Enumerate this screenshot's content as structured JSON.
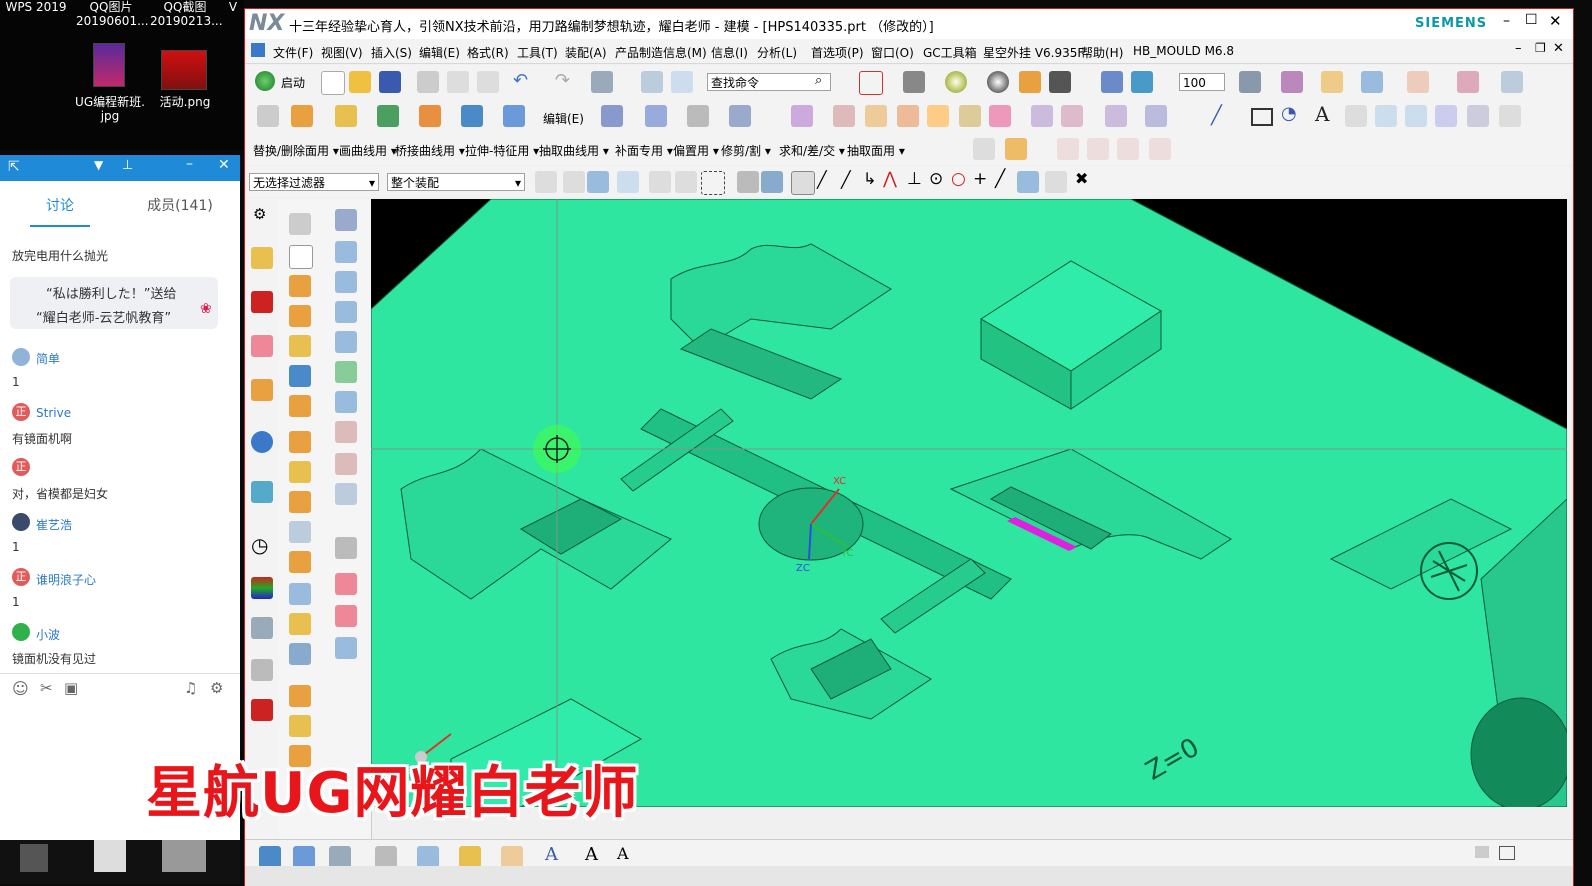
{
  "desktop": {
    "icons": [
      {
        "label1": "WPS 2019",
        "label2": ""
      },
      {
        "label1": "QQ图片",
        "label2": "20190601..."
      },
      {
        "label1": "QQ截图",
        "label2": "20190213..."
      },
      {
        "label1": "UG编程新班.",
        "label2": "jpg"
      },
      {
        "label1": "活动.png",
        "label2": ""
      }
    ],
    "partial_v": "V"
  },
  "chat": {
    "tabs": [
      "讨论",
      "成员(141)"
    ],
    "first_line": "放完电用什么抛光",
    "bubble_line1": "“私は勝利した！”送给",
    "bubble_line2": "“耀白老师-云艺帆教育”",
    "messages": [
      {
        "name": "简单",
        "text": "1",
        "avatar_color": "#8fb3d9"
      },
      {
        "name": "Strive",
        "text": "有镜面机啊",
        "avatar_color": "#e15b5b",
        "avatar_char": "正"
      },
      {
        "name": "",
        "text": "对，省模都是妇女",
        "avatar_color": "#e15b5b",
        "avatar_char": "正"
      },
      {
        "name": "崔艺浩",
        "text": "1",
        "avatar_color": "#3a4a6a"
      },
      {
        "name": "谁明浪子心",
        "text": "1",
        "avatar_color": "#e15b5b",
        "avatar_char": "正"
      },
      {
        "name": "小波",
        "text": "镜面机没有见过",
        "avatar_color": "#2fb24c"
      }
    ]
  },
  "nx": {
    "logo": "NX",
    "title": "十三年经验挚心育人，引领NX技术前沿，用刀路编制梦想轨迹，耀白老师 - 建模 - [HPS140335.prt （修改的）]",
    "brand": "SIEMENS",
    "menu": [
      "文件(F)",
      "视图(V)",
      "插入(S)",
      "编辑(E)",
      "格式(R)",
      "工具(T)",
      "装配(A)",
      "产品制造信息(M)",
      "信息(I)",
      "分析(L)",
      "首选项(P)",
      "窗口(O)",
      "GC工具箱",
      "星空外挂 V6.935F",
      "帮助(H)",
      "HB_MOULD M6.8"
    ],
    "start_label": "启动",
    "find_command_placeholder": "查找命令",
    "zoom_value": "100",
    "edit_label": "编辑(E)",
    "surface_menu": [
      "替换/删除面用",
      "画曲线用",
      "桥接曲线用",
      "拉伸-特征用",
      "抽取曲线用",
      "补面专用",
      "偏置用",
      "修剪/割",
      "求和/差/交",
      "抽取面用"
    ],
    "filter_value": "无选择过滤器",
    "assembly_value": "整个装配",
    "viewport_labels": {
      "xc": "XC",
      "yc": "YC",
      "zc": "ZC",
      "z0": "Z=0"
    },
    "accent_green": "#2ee6a0",
    "magenta": "#e020e0"
  },
  "overlay": {
    "text": "星航UG网耀白老师"
  }
}
